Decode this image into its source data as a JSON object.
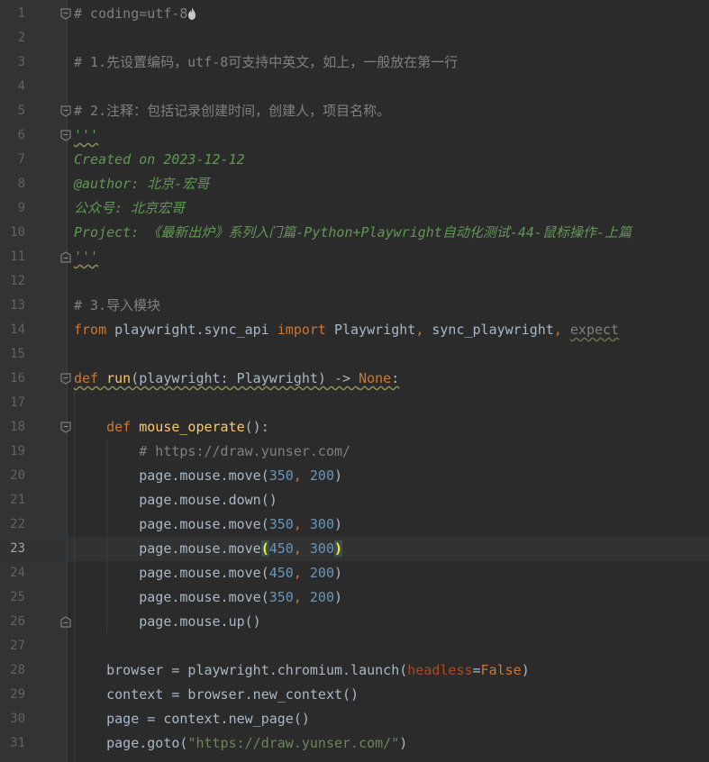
{
  "editor": {
    "current_line": 23,
    "lines": [
      {
        "n": "1",
        "fold": "start",
        "tokens": [
          [
            "# coding=utf-8",
            "cmt"
          ]
        ],
        "flame": true
      },
      {
        "n": "2",
        "tokens": []
      },
      {
        "n": "3",
        "tokens": [
          [
            "# 1.先设置编码，utf-8可支持中英文，如上，一般放在第一行",
            "cmt"
          ]
        ]
      },
      {
        "n": "4",
        "tokens": []
      },
      {
        "n": "5",
        "fold": "start",
        "tokens": [
          [
            "# 2.注释：包括记录创建时间，创建人，项目名称。",
            "cmt"
          ]
        ]
      },
      {
        "n": "6",
        "fold": "start",
        "tokens": [
          [
            "'''",
            "doc warn"
          ]
        ]
      },
      {
        "n": "7",
        "tokens": [
          [
            "Created on 2023-12-12",
            "doc"
          ]
        ]
      },
      {
        "n": "8",
        "tokens": [
          [
            "@author: 北京-宏哥",
            "doc"
          ]
        ]
      },
      {
        "n": "9",
        "tokens": [
          [
            "公众号: 北京宏哥",
            "doc"
          ]
        ]
      },
      {
        "n": "10",
        "tokens": [
          [
            "Project: 《最新出炉》系列入门篇-Python+Playwright自动化测试-44-鼠标操作-上篇",
            "doc"
          ]
        ]
      },
      {
        "n": "11",
        "fold": "end",
        "tokens": [
          [
            "'''",
            "doc warn"
          ]
        ]
      },
      {
        "n": "12",
        "tokens": []
      },
      {
        "n": "13",
        "tokens": [
          [
            "# 3.导入模块",
            "cmt"
          ]
        ]
      },
      {
        "n": "14",
        "tokens": [
          [
            "from",
            "kw"
          ],
          [
            " playwright.sync_api ",
            ""
          ],
          [
            "import",
            "kw"
          ],
          [
            " Playwright",
            ""
          ],
          [
            ", ",
            "kw"
          ],
          [
            "sync_playwright",
            ""
          ],
          [
            ", ",
            "kw"
          ],
          [
            "expect",
            "cmt weak"
          ]
        ]
      },
      {
        "n": "15",
        "tokens": []
      },
      {
        "n": "16",
        "fold": "start",
        "tokens": [
          [
            "def",
            "kw warn"
          ],
          [
            " ",
            "warn"
          ],
          [
            "run",
            "fn warn"
          ],
          [
            "(playwright: Playwright) -> ",
            "warn"
          ],
          [
            "None",
            "kw warn"
          ],
          [
            ":",
            "warn"
          ]
        ]
      },
      {
        "n": "17",
        "tokens": []
      },
      {
        "n": "18",
        "fold": "start",
        "tokens": [
          [
            "    ",
            ""
          ],
          [
            "def",
            "kw"
          ],
          [
            " ",
            ""
          ],
          [
            "mouse_operate",
            "fn"
          ],
          [
            "():",
            ""
          ]
        ]
      },
      {
        "n": "19",
        "tokens": [
          [
            "        ",
            ""
          ],
          [
            "# https://draw.yunser.com/",
            "cmt"
          ]
        ]
      },
      {
        "n": "20",
        "tokens": [
          [
            "        page.mouse.move(",
            ""
          ],
          [
            "350",
            "num"
          ],
          [
            ", ",
            "kw"
          ],
          [
            "200",
            "num"
          ],
          [
            ")",
            ""
          ]
        ]
      },
      {
        "n": "21",
        "tokens": [
          [
            "        page.mouse.down()",
            ""
          ]
        ]
      },
      {
        "n": "22",
        "tokens": [
          [
            "        page.mouse.move(",
            ""
          ],
          [
            "350",
            "num"
          ],
          [
            ", ",
            "kw"
          ],
          [
            "300",
            "num"
          ],
          [
            ")",
            ""
          ]
        ]
      },
      {
        "n": "23",
        "tokens": [
          [
            "        page.mouse.move",
            ""
          ],
          [
            "(",
            "brace"
          ],
          [
            "450",
            "num"
          ],
          [
            ", ",
            "kw"
          ],
          [
            "300",
            "num"
          ],
          [
            ")",
            "brace"
          ]
        ]
      },
      {
        "n": "24",
        "tokens": [
          [
            "        page.mouse.move(",
            ""
          ],
          [
            "450",
            "num"
          ],
          [
            ", ",
            "kw"
          ],
          [
            "200",
            "num"
          ],
          [
            ")",
            ""
          ]
        ]
      },
      {
        "n": "25",
        "tokens": [
          [
            "        page.mouse.move(",
            ""
          ],
          [
            "350",
            "num"
          ],
          [
            ", ",
            "kw"
          ],
          [
            "200",
            "num"
          ],
          [
            ")",
            ""
          ]
        ]
      },
      {
        "n": "26",
        "fold": "end",
        "tokens": [
          [
            "        page.mouse.up()",
            ""
          ]
        ]
      },
      {
        "n": "27",
        "tokens": []
      },
      {
        "n": "28",
        "tokens": [
          [
            "    browser = playwright.chromium.launch(",
            ""
          ],
          [
            "headless",
            "param"
          ],
          [
            "=",
            ""
          ],
          [
            "False",
            "kw"
          ],
          [
            ")",
            ""
          ]
        ]
      },
      {
        "n": "29",
        "tokens": [
          [
            "    context = browser.new_context()",
            ""
          ]
        ]
      },
      {
        "n": "30",
        "tokens": [
          [
            "    page = context.new_page()",
            ""
          ]
        ]
      },
      {
        "n": "31",
        "tokens": [
          [
            "    page.goto(",
            ""
          ],
          [
            "\"https://draw.yunser.com/\"",
            "str"
          ],
          [
            ")",
            ""
          ]
        ]
      }
    ]
  }
}
